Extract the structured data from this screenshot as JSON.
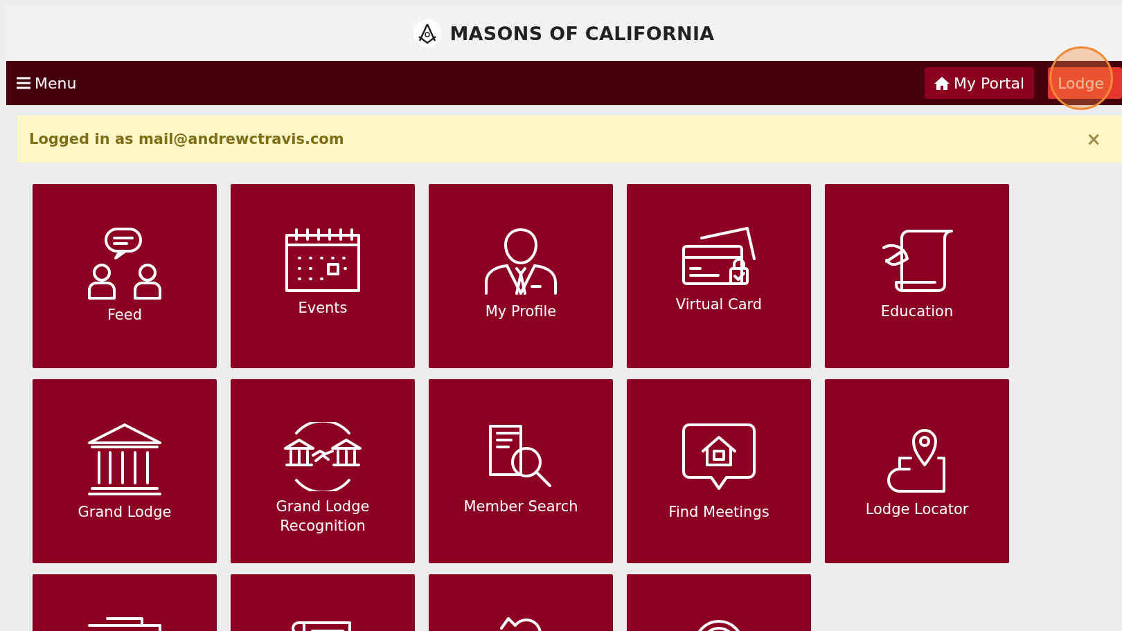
{
  "header": {
    "title": "MASONS OF CALIFORNIA"
  },
  "nav": {
    "menu_label": "Menu",
    "buttons": [
      {
        "label": "My Portal",
        "kind": "portal"
      },
      {
        "label": "Lodge",
        "kind": "lodge"
      }
    ]
  },
  "alert": {
    "text": "Logged in as mail@andrewctravis.com",
    "close": "×"
  },
  "tiles": [
    {
      "kind": "full",
      "label": "Feed"
    },
    {
      "kind": "full",
      "label": "Events"
    },
    {
      "kind": "full",
      "label": "My Profile"
    },
    {
      "kind": "full",
      "label": "Virtual Card"
    },
    {
      "kind": "full",
      "label": "Education"
    },
    {
      "kind": "full",
      "label": "Grand Lodge"
    },
    {
      "kind": "full",
      "label": "Grand Lodge Recognition"
    },
    {
      "kind": "full",
      "label": "Member Search"
    },
    {
      "kind": "full",
      "label": "Find Meetings"
    },
    {
      "kind": "full",
      "label": "Lodge Locator"
    },
    {
      "kind": "cut"
    },
    {
      "kind": "cut"
    },
    {
      "kind": "cut"
    },
    {
      "kind": "cut"
    }
  ]
}
